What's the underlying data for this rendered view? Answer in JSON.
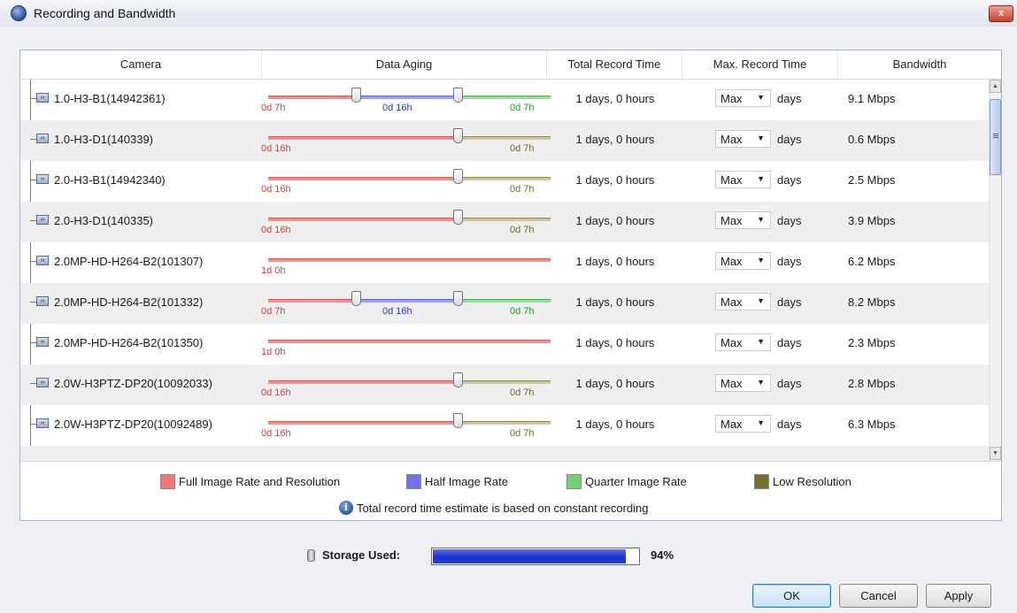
{
  "window": {
    "title": "Recording and Bandwidth",
    "close_label": "x"
  },
  "table": {
    "columns": {
      "camera": "Camera",
      "data_aging": "Data Aging",
      "total_record_time": "Total Record Time",
      "max_record_time": "Max. Record Time",
      "bandwidth": "Bandwidth"
    },
    "rows": [
      {
        "camera": "1.0-H3-B1(14942361)",
        "aging_type": "full-half-quarter",
        "aging_labels": [
          "0d 7h",
          "0d 16h",
          "0d 7h"
        ],
        "record_time": "1 days, 0 hours",
        "max_value": "Max",
        "days_label": "days",
        "bandwidth": "9.1 Mbps"
      },
      {
        "camera": "1.0-H3-D1(140339)",
        "aging_type": "full-low",
        "aging_labels": [
          "0d 16h",
          "0d 7h"
        ],
        "record_time": "1 days, 0 hours",
        "max_value": "Max",
        "days_label": "days",
        "bandwidth": "0.6 Mbps"
      },
      {
        "camera": "2.0-H3-B1(14942340)",
        "aging_type": "full-low",
        "aging_labels": [
          "0d 16h",
          "0d 7h"
        ],
        "record_time": "1 days, 0 hours",
        "max_value": "Max",
        "days_label": "days",
        "bandwidth": "2.5 Mbps"
      },
      {
        "camera": "2.0-H3-D1(140335)",
        "aging_type": "full-low",
        "aging_labels": [
          "0d 16h",
          "0d 7h"
        ],
        "record_time": "1 days, 0 hours",
        "max_value": "Max",
        "days_label": "days",
        "bandwidth": "3.9 Mbps"
      },
      {
        "camera": "2.0MP-HD-H264-B2(101307)",
        "aging_type": "full",
        "aging_labels": [
          "1d 0h"
        ],
        "record_time": "1 days, 0 hours",
        "max_value": "Max",
        "days_label": "days",
        "bandwidth": "6.2 Mbps"
      },
      {
        "camera": "2.0MP-HD-H264-B2(101332)",
        "aging_type": "full-half-quarter",
        "aging_labels": [
          "0d 7h",
          "0d 16h",
          "0d 7h"
        ],
        "record_time": "1 days, 0 hours",
        "max_value": "Max",
        "days_label": "days",
        "bandwidth": "8.2 Mbps"
      },
      {
        "camera": "2.0MP-HD-H264-B2(101350)",
        "aging_type": "full",
        "aging_labels": [
          "1d 0h"
        ],
        "record_time": "1 days, 0 hours",
        "max_value": "Max",
        "days_label": "days",
        "bandwidth": "2.3 Mbps"
      },
      {
        "camera": "2.0W-H3PTZ-DP20(10092033)",
        "aging_type": "full-low",
        "aging_labels": [
          "0d 16h",
          "0d 7h"
        ],
        "record_time": "1 days, 0 hours",
        "max_value": "Max",
        "days_label": "days",
        "bandwidth": "2.8 Mbps"
      },
      {
        "camera": "2.0W-H3PTZ-DP20(10092489)",
        "aging_type": "full-low",
        "aging_labels": [
          "0d 16h",
          "0d 7h"
        ],
        "record_time": "1 days, 0 hours",
        "max_value": "Max",
        "days_label": "days",
        "bandwidth": "6.3 Mbps"
      }
    ]
  },
  "legend": {
    "full": "Full Image Rate and Resolution",
    "half": "Half Image Rate",
    "quarter": "Quarter Image Rate",
    "low": "Low Resolution",
    "note": "Total record time estimate is based on constant recording"
  },
  "colors": {
    "full": "#ef7878",
    "half": "#6f72e8",
    "quarter": "#6fd46f",
    "low": "#7a6f2a"
  },
  "storage": {
    "label": "Storage Used:",
    "percent_label": "94%",
    "fraction": 0.94
  },
  "buttons": {
    "ok": "OK",
    "cancel": "Cancel",
    "apply": "Apply"
  },
  "icons": {
    "info": "i",
    "sort_up": "▲",
    "sort_down": "▼",
    "dropdown": "▼",
    "camera": "∞"
  }
}
